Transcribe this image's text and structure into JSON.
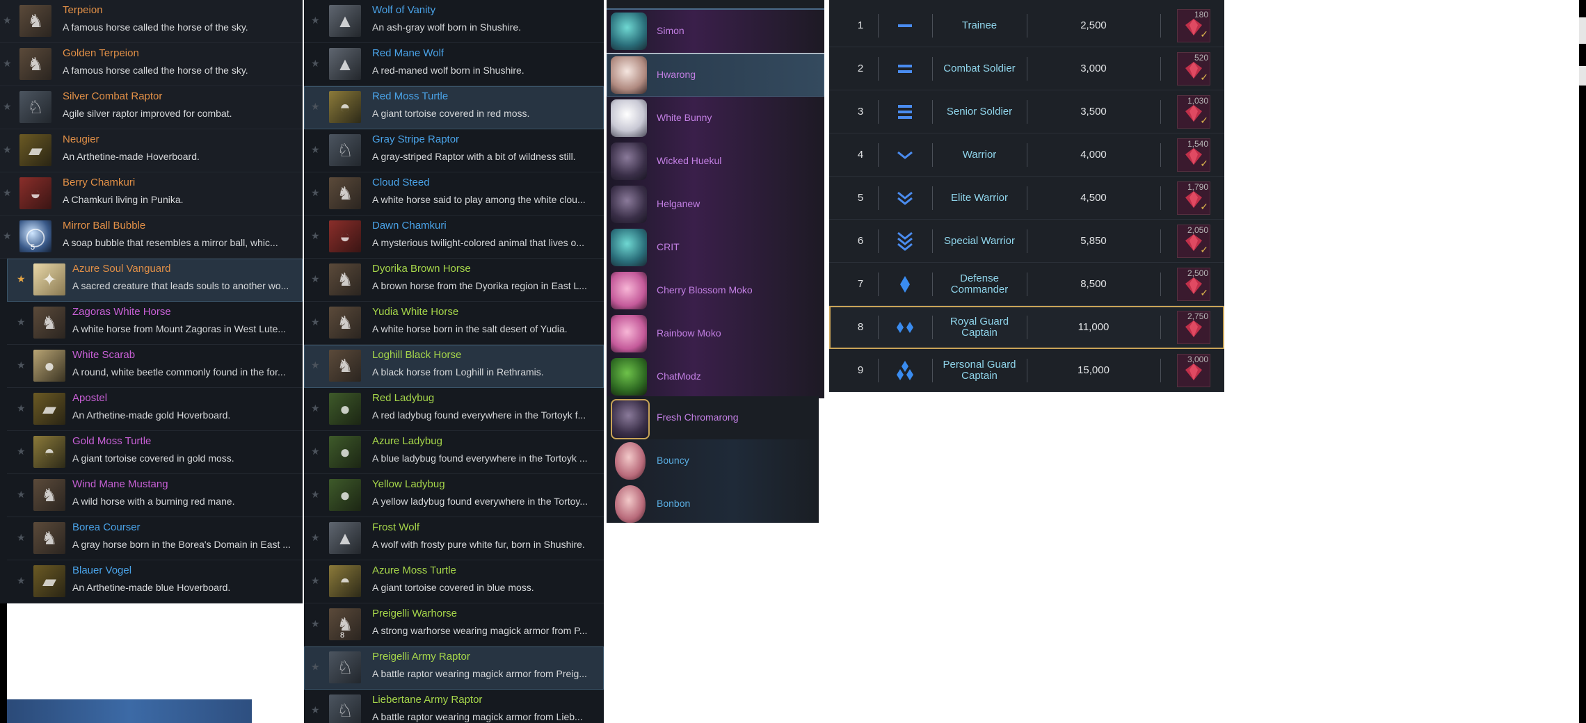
{
  "column_a": {
    "items": [
      {
        "name": "Terpeion",
        "desc": "A famous horse called the horse of the sky.",
        "color": "o",
        "icon": "horse-icon",
        "star": false,
        "selected": false
      },
      {
        "name": "Golden Terpeion",
        "desc": "A famous horse called the horse of the sky.",
        "color": "o",
        "icon": "horse-icon",
        "star": false,
        "selected": false
      },
      {
        "name": "Silver Combat Raptor",
        "desc": "Agile silver raptor improved for combat.",
        "color": "o",
        "icon": "raptor-icon",
        "star": false,
        "selected": false
      },
      {
        "name": "Neugier",
        "desc": "An Arthetine-made Hoverboard.",
        "color": "o",
        "icon": "hoverboard-icon",
        "star": false,
        "selected": false
      },
      {
        "name": "Berry Chamkuri",
        "desc": "A Chamkuri living in Punika.",
        "color": "o",
        "icon": "chamkuri-icon",
        "star": false,
        "selected": false
      },
      {
        "name": "Mirror Ball Bubble",
        "desc": "A soap bubble that resembles a mirror ball, whic...",
        "color": "o",
        "icon": "bubble-icon",
        "star": false,
        "selected": false,
        "count": "5"
      },
      {
        "name": "Azure Soul Vanguard",
        "desc": "A sacred creature that leads souls to another wo...",
        "color": "o",
        "icon": "soul-icon",
        "star": true,
        "selected": true
      },
      {
        "name": "Zagoras White Horse",
        "desc": "A white horse from Mount Zagoras in West Lute...",
        "color": "p",
        "icon": "horse-icon",
        "star": false,
        "selected": false
      },
      {
        "name": "White Scarab",
        "desc": "A round, white beetle commonly found in the for...",
        "color": "p",
        "icon": "beetle-icon",
        "star": false,
        "selected": false
      },
      {
        "name": "Apostel",
        "desc": "An Arthetine-made gold Hoverboard.",
        "color": "p",
        "icon": "hoverboard-icon",
        "star": false,
        "selected": false
      },
      {
        "name": "Gold Moss Turtle",
        "desc": "A giant tortoise covered in gold moss.",
        "color": "p",
        "icon": "turtle-icon",
        "star": false,
        "selected": false
      },
      {
        "name": "Wind Mane Mustang",
        "desc": "A wild horse with a burning red mane.",
        "color": "p",
        "icon": "horse-icon",
        "star": false,
        "selected": false
      },
      {
        "name": "Borea Courser",
        "desc": "A gray horse born in the Borea's Domain in East ...",
        "color": "b",
        "icon": "horse-icon",
        "star": false,
        "selected": false
      },
      {
        "name": "Blauer Vogel",
        "desc": "An Arthetine-made blue Hoverboard.",
        "color": "b",
        "icon": "hoverboard-icon",
        "star": false,
        "selected": false
      }
    ]
  },
  "column_b": {
    "items": [
      {
        "name": "Wolf of Vanity",
        "desc": "An ash-gray wolf born in Shushire.",
        "color": "b",
        "icon": "wolf-icon",
        "selected": false
      },
      {
        "name": "Red Mane Wolf",
        "desc": "A red-maned wolf born in Shushire.",
        "color": "b",
        "icon": "wolf-icon",
        "selected": false
      },
      {
        "name": "Red Moss Turtle",
        "desc": "A giant tortoise covered in red moss.",
        "color": "b",
        "icon": "turtle-icon",
        "selected": true
      },
      {
        "name": "Gray Stripe Raptor",
        "desc": "A gray-striped Raptor with a bit of wildness still.",
        "color": "b",
        "icon": "raptor-icon",
        "selected": false
      },
      {
        "name": "Cloud Steed",
        "desc": "A white horse said to play among the white clou...",
        "color": "b",
        "icon": "horse-icon",
        "selected": false
      },
      {
        "name": "Dawn Chamkuri",
        "desc": "A mysterious twilight-colored animal that lives o...",
        "color": "b",
        "icon": "chamkuri-icon",
        "selected": false
      },
      {
        "name": "Dyorika Brown Horse",
        "desc": "A brown horse from the Dyorika region in East L...",
        "color": "g",
        "icon": "horse-icon",
        "selected": false
      },
      {
        "name": "Yudia White Horse",
        "desc": "A white horse born in the salt desert of Yudia.",
        "color": "g",
        "icon": "horse-icon",
        "selected": false
      },
      {
        "name": "Loghill Black Horse",
        "desc": "A black horse from Loghill in Rethramis.",
        "color": "g",
        "icon": "horse-icon",
        "selected": true
      },
      {
        "name": "Red Ladybug",
        "desc": "A red ladybug found everywhere in the Tortoyk f...",
        "color": "g",
        "icon": "ladybug-icon",
        "selected": false
      },
      {
        "name": "Azure Ladybug",
        "desc": "A blue ladybug found everywhere in the Tortoyk ...",
        "color": "g",
        "icon": "ladybug-icon",
        "selected": false
      },
      {
        "name": "Yellow Ladybug",
        "desc": "A yellow ladybug found everywhere in the Tortoy...",
        "color": "g",
        "icon": "ladybug-icon",
        "selected": false
      },
      {
        "name": "Frost Wolf",
        "desc": "A wolf with frosty pure white fur, born in Shushire.",
        "color": "g",
        "icon": "wolf-icon",
        "selected": false
      },
      {
        "name": "Azure Moss Turtle",
        "desc": "A giant tortoise covered in blue moss.",
        "color": "g",
        "icon": "turtle-icon",
        "selected": false
      },
      {
        "name": "Preigelli Warhorse",
        "desc": "A strong warhorse wearing magick armor from P...",
        "color": "g",
        "icon": "horse-icon",
        "selected": false,
        "count": "8"
      },
      {
        "name": "Preigelli Army Raptor",
        "desc": "A battle raptor wearing magick armor from Preig...",
        "color": "g",
        "icon": "raptor-icon",
        "selected": true
      },
      {
        "name": "Liebertane Army Raptor",
        "desc": "A battle raptor wearing magick armor from Lieb...",
        "color": "g",
        "icon": "raptor-icon",
        "selected": false
      }
    ]
  },
  "column_c": {
    "pets": [
      {
        "name": "Simon",
        "style": "purple",
        "icon": "cat-icon"
      },
      {
        "name": "Hwarong",
        "style": "sel",
        "icon": "bird-icon"
      },
      {
        "name": "White Bunny",
        "style": "purple",
        "icon": "bunny-icon"
      },
      {
        "name": "Wicked Huekul",
        "style": "purple",
        "icon": "creature-icon"
      },
      {
        "name": "Helganew",
        "style": "purple",
        "icon": "creature-icon"
      },
      {
        "name": "CRIT",
        "style": "purple",
        "icon": "cat-icon"
      },
      {
        "name": "Cherry Blossom Moko",
        "style": "purple",
        "icon": "moko-icon"
      },
      {
        "name": "Rainbow Moko",
        "style": "purple",
        "icon": "moko-icon"
      },
      {
        "name": "ChatModz",
        "style": "purple",
        "icon": "dragon-icon"
      },
      {
        "name": "Fresh Chromarong",
        "style": "dark",
        "icon": "creature-icon"
      },
      {
        "name": "Bouncy",
        "style": "blueish",
        "icon": "egg-icon"
      },
      {
        "name": "Bonbon",
        "style": "blueish",
        "icon": "egg-icon"
      }
    ]
  },
  "column_d": {
    "ranks": [
      {
        "num": "1",
        "title": "Trainee",
        "value": "2,500",
        "reward": "180",
        "claimed": true,
        "highlight": false,
        "insignia": "bar1"
      },
      {
        "num": "2",
        "title": "Combat Soldier",
        "value": "3,000",
        "reward": "520",
        "claimed": true,
        "highlight": false,
        "insignia": "bar2"
      },
      {
        "num": "3",
        "title": "Senior Soldier",
        "value": "3,500",
        "reward": "1,030",
        "claimed": true,
        "highlight": false,
        "insignia": "bar3"
      },
      {
        "num": "4",
        "title": "Warrior",
        "value": "4,000",
        "reward": "1,540",
        "claimed": true,
        "highlight": false,
        "insignia": "chev1"
      },
      {
        "num": "5",
        "title": "Elite Warrior",
        "value": "4,500",
        "reward": "1,790",
        "claimed": true,
        "highlight": false,
        "insignia": "chev2"
      },
      {
        "num": "6",
        "title": "Special Warrior",
        "value": "5,850",
        "reward": "2,050",
        "claimed": true,
        "highlight": false,
        "insignia": "chev3"
      },
      {
        "num": "7",
        "title": "Defense Commander",
        "value": "8,500",
        "reward": "2,500",
        "claimed": true,
        "highlight": false,
        "insignia": "dia1"
      },
      {
        "num": "8",
        "title": "Royal Guard Captain",
        "value": "11,000",
        "reward": "2,750",
        "claimed": false,
        "highlight": true,
        "insignia": "dia2"
      },
      {
        "num": "9",
        "title": "Personal Guard Captain",
        "value": "15,000",
        "reward": "3,000",
        "claimed": false,
        "highlight": false,
        "insignia": "dia3"
      }
    ],
    "check_glyph": "✓"
  },
  "colors": {
    "legendary": "#e29047",
    "uncommon": "#a6d64a",
    "epic": "#c860d6",
    "rare": "#4aa3e8",
    "rank_title": "#8fd4ea",
    "highlight_border": "#c9a458"
  },
  "star_glyph": "★"
}
